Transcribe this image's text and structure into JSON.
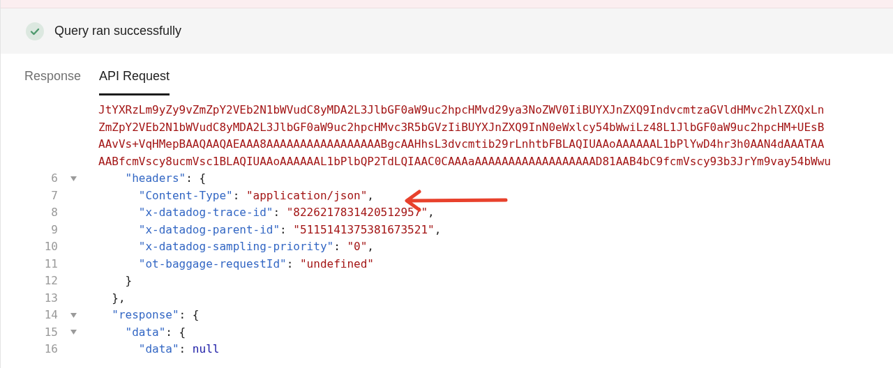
{
  "status": {
    "message": "Query ran successfully",
    "success": true
  },
  "tabs": [
    {
      "label": "Response",
      "selected": false
    },
    {
      "label": "API Request",
      "selected": true
    }
  ],
  "code_lines": [
    {
      "kind": "wrap",
      "tokens": [
        {
          "kind": "string",
          "text": "JtYXRzLm9yZy9vZmZpY2VEb2N1bWVudC8yMDA2L3JlbGF0aW9uc2hpcHMvd29ya3NoZWV0IiBUYXJnZXQ9IndvcmtzaGVldHMvc2hlZXQxLn"
        }
      ]
    },
    {
      "kind": "wrap",
      "tokens": [
        {
          "kind": "string",
          "text": "ZmZpY2VEb2N1bWVudC8yMDA2L3JlbGF0aW9uc2hpcHMvc3R5bGVzIiBUYXJnZXQ9InN0eWxlcy54bWwiLz48L1JlbGF0aW9uc2hpcHM+UEsB"
        }
      ]
    },
    {
      "kind": "wrap",
      "tokens": [
        {
          "kind": "string",
          "text": "AAvVs+VqHMepBAAQAAQAEAAA8AAAAAAAAAAAAAAAAABgcAAHhsL3dvcmtib29rLnhtbFBLAQIUAAoAAAAAAL1bPlYwD4hr3h0AAN4dAAATAA"
        }
      ]
    },
    {
      "kind": "wrap",
      "tokens": [
        {
          "kind": "string",
          "text": "AABfcmVscy8ucmVsc1BLAQIUAAoAAAAAAL1bPlbQP2TdLQIAAC0CAAAaAAAAAAAAAAAAAAAAAAD81AAB4bC9fcmVscy93b3JrYm9vay54bWwu"
        }
      ]
    },
    {
      "kind": "line",
      "number": "6",
      "fold": true,
      "tokens": [
        {
          "kind": "key",
          "text": "    \"headers\""
        },
        {
          "kind": "punct",
          "text": ": {"
        }
      ]
    },
    {
      "kind": "line",
      "number": "7",
      "fold": false,
      "tokens": [
        {
          "kind": "key",
          "text": "      \"Content-Type\""
        },
        {
          "kind": "punct",
          "text": ": "
        },
        {
          "kind": "string",
          "text": "\"application/json\""
        },
        {
          "kind": "punct",
          "text": ","
        }
      ]
    },
    {
      "kind": "line",
      "number": "8",
      "fold": false,
      "tokens": [
        {
          "kind": "key",
          "text": "      \"x-datadog-trace-id\""
        },
        {
          "kind": "punct",
          "text": ": "
        },
        {
          "kind": "string",
          "text": "\"8226217831420512957\""
        },
        {
          "kind": "punct",
          "text": ","
        }
      ]
    },
    {
      "kind": "line",
      "number": "9",
      "fold": false,
      "tokens": [
        {
          "kind": "key",
          "text": "      \"x-datadog-parent-id\""
        },
        {
          "kind": "punct",
          "text": ": "
        },
        {
          "kind": "string",
          "text": "\"5115141375381673521\""
        },
        {
          "kind": "punct",
          "text": ","
        }
      ]
    },
    {
      "kind": "line",
      "number": "10",
      "fold": false,
      "tokens": [
        {
          "kind": "key",
          "text": "      \"x-datadog-sampling-priority\""
        },
        {
          "kind": "punct",
          "text": ": "
        },
        {
          "kind": "string",
          "text": "\"0\""
        },
        {
          "kind": "punct",
          "text": ","
        }
      ]
    },
    {
      "kind": "line",
      "number": "11",
      "fold": false,
      "tokens": [
        {
          "kind": "key",
          "text": "      \"ot-baggage-requestId\""
        },
        {
          "kind": "punct",
          "text": ": "
        },
        {
          "kind": "string",
          "text": "\"undefined\""
        }
      ]
    },
    {
      "kind": "line",
      "number": "12",
      "fold": false,
      "tokens": [
        {
          "kind": "punct",
          "text": "    }"
        }
      ]
    },
    {
      "kind": "line",
      "number": "13",
      "fold": false,
      "tokens": [
        {
          "kind": "punct",
          "text": "  },"
        }
      ]
    },
    {
      "kind": "line",
      "number": "14",
      "fold": true,
      "tokens": [
        {
          "kind": "key",
          "text": "  \"response\""
        },
        {
          "kind": "punct",
          "text": ": {"
        }
      ]
    },
    {
      "kind": "line",
      "number": "15",
      "fold": true,
      "tokens": [
        {
          "kind": "key",
          "text": "    \"data\""
        },
        {
          "kind": "punct",
          "text": ": {"
        }
      ]
    },
    {
      "kind": "line",
      "number": "16",
      "fold": false,
      "tokens": [
        {
          "kind": "key",
          "text": "      \"data\""
        },
        {
          "kind": "punct",
          "text": ": "
        },
        {
          "kind": "keyword",
          "text": "null"
        }
      ]
    }
  ]
}
